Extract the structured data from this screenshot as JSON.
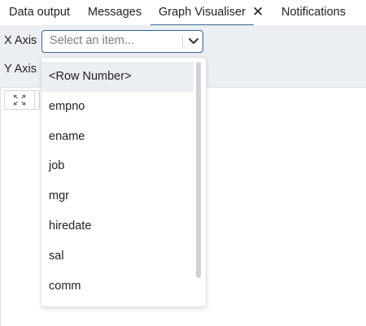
{
  "tabs": [
    {
      "label": "Data output"
    },
    {
      "label": "Messages"
    },
    {
      "label": "Graph Visualiser",
      "active": true
    },
    {
      "label": "Notifications"
    }
  ],
  "tab_close_icon": "✕",
  "options": {
    "x_axis_label": "X Axis",
    "y_axis_label": "Y Axis",
    "x_select_placeholder": "Select an item..."
  },
  "dropdown": {
    "items": [
      {
        "label": "<Row Number>",
        "highlighted": true
      },
      {
        "label": "empno"
      },
      {
        "label": "ename"
      },
      {
        "label": "job"
      },
      {
        "label": "mgr"
      },
      {
        "label": "hiredate"
      },
      {
        "label": "sal"
      },
      {
        "label": "comm"
      }
    ]
  },
  "icons": {
    "chevron": "chevron-down-icon",
    "expand": "expand-icon",
    "close": "close-icon"
  },
  "colors": {
    "accent": "#326690",
    "panel_bg": "#ebeef3",
    "highlight_bg": "#ebeef3"
  }
}
